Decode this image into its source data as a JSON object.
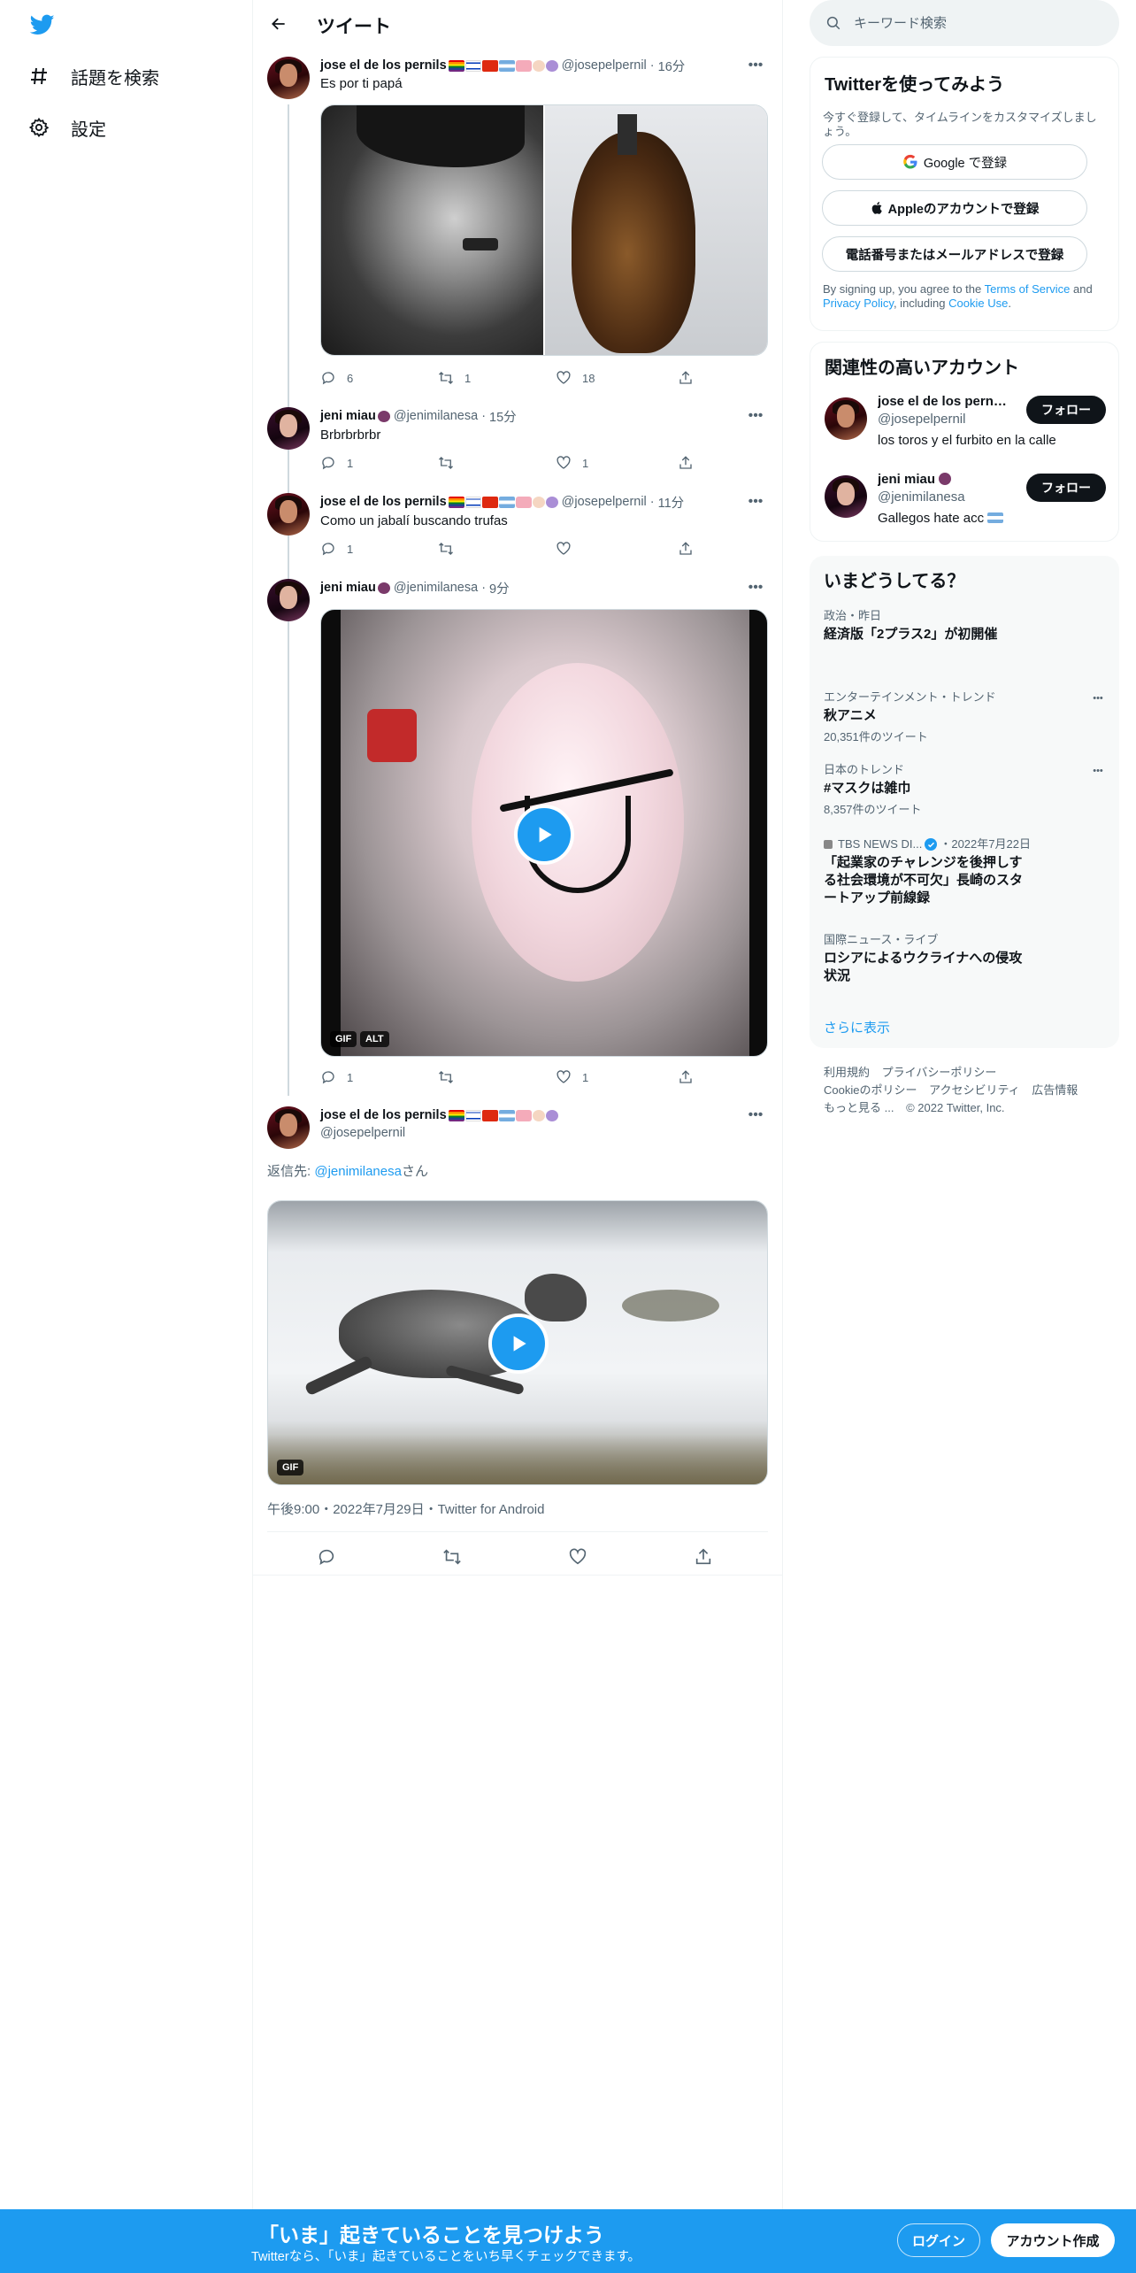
{
  "colors": {
    "accent": "#1d9bf0",
    "text": "#0f1419",
    "secondary": "#536471",
    "border": "#eff3f4"
  },
  "nav": {
    "logo_icon": "twitter-bird-icon",
    "items": [
      {
        "icon": "hashtag-icon",
        "label": "話題を検索"
      },
      {
        "icon": "gear-icon",
        "label": "設定"
      }
    ]
  },
  "header": {
    "title": "ツイート",
    "back_icon": "arrow-left-icon"
  },
  "tweets": [
    {
      "name": "jose el de los pernils",
      "handle": "@josepelpernil",
      "time": "16分",
      "text": "Es por ti papá",
      "replies": "6",
      "retweets": "1",
      "likes": "18"
    },
    {
      "name": "jeni miau",
      "handle": "@jenimilanesa",
      "time": "15分",
      "text": "Brbrbrbrbr",
      "replies": "1",
      "retweets": "",
      "likes": "1"
    },
    {
      "name": "jose el de los pernils",
      "handle": "@josepelpernil",
      "time": "11分",
      "text": "Como un jabalí buscando trufas",
      "replies": "1",
      "retweets": "",
      "likes": ""
    },
    {
      "name": "jeni miau",
      "handle": "@jenimilanesa",
      "time": "9分",
      "text": "",
      "replies": "1",
      "retweets": "",
      "likes": "1",
      "badges": [
        "GIF",
        "ALT"
      ]
    }
  ],
  "focus_tweet": {
    "name": "jose el de los pernils",
    "handle": "@josepelpernil",
    "reply_prefix": "返信先: ",
    "reply_to": "@jenimilanesa",
    "reply_suffix": "さん",
    "badge": "GIF",
    "meta": "午後9:00・2022年7月29日・Twitter for Android"
  },
  "search": {
    "placeholder": "キーワード検索"
  },
  "signup": {
    "title": "Twitterを使ってみよう",
    "desc": "今すぐ登録して、タイムラインをカスタマイズしましょう。",
    "google": "Google で登録",
    "apple": "Appleのアカウントで登録",
    "phone": "電話番号またはメールアドレスで登録",
    "terms_1": "By signing up, you agree to the ",
    "terms_link1": "Terms of Service",
    "terms_2": " and ",
    "terms_link2": "Privacy Policy",
    "terms_3": ", including ",
    "terms_link3": "Cookie Use",
    "terms_4": "."
  },
  "related": {
    "title": "関連性の高いアカウント",
    "follow_label": "フォロー",
    "users": [
      {
        "name": "jose el de los pernils...",
        "handle": "@josepelpernil",
        "bio": "los toros y el furbito en la calle"
      },
      {
        "name": "jeni miau",
        "handle": "@jenimilanesa",
        "bio": "Gallegos hate acc"
      }
    ]
  },
  "trends": {
    "title": "いまどうしてる？",
    "items": [
      {
        "meta": "政治・昨日",
        "title": "経済版「2プラス2」が初開催",
        "count": ""
      },
      {
        "meta": "エンターテインメント・トレンド",
        "title": "秋アニメ",
        "count": "20,351件のツイート"
      },
      {
        "meta": "日本のトレンド",
        "title": "#マスクは雑巾",
        "count": "8,357件のツイート"
      },
      {
        "meta_source": "TBS NEWS DI...",
        "meta_date": "・2022年7月22日",
        "title": "「起業家のチャレンジを後押しする社会環境が不可欠」長崎のスタートアップ前線録",
        "count": ""
      },
      {
        "meta": "国際ニュース・ライブ",
        "title": "ロシアによるウクライナへの侵攻状況",
        "count": ""
      }
    ],
    "show_more": "さらに表示"
  },
  "footer": {
    "links": [
      "利用規約",
      "プライバシーポリシー",
      "Cookieのポリシー",
      "アクセシビリティ",
      "広告情報",
      "もっと見る ..."
    ],
    "copyright": "© 2022 Twitter, Inc."
  },
  "banner": {
    "title": "「いま」起きていることを見つけよう",
    "subtitle": "Twitterなら、「いま」起きていることをいち早くチェックできます。",
    "login": "ログイン",
    "signup": "アカウント作成"
  }
}
